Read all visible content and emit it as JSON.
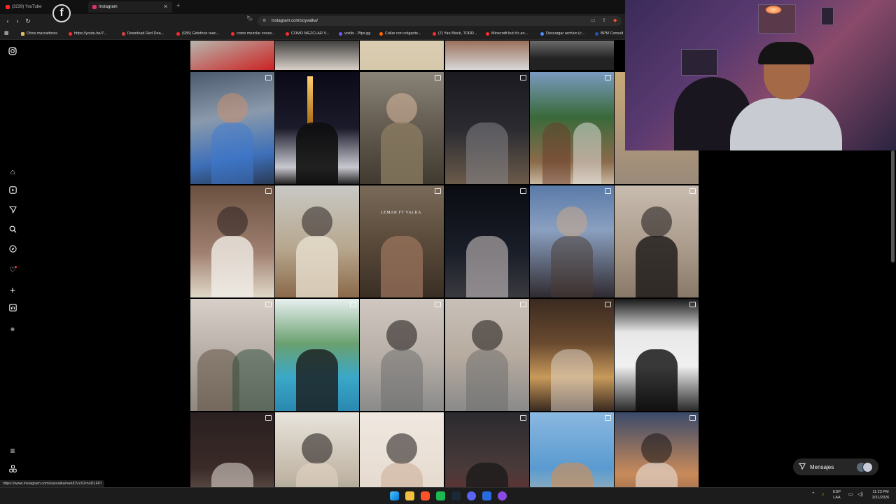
{
  "browser": {
    "tabs": [
      {
        "title": "(3239) YouTube",
        "favicon_color": "#ff2b2b"
      },
      {
        "title": "Instagram",
        "favicon_color": "#e1306c"
      }
    ],
    "new_tab_symbol": "+",
    "url": "instagram.com/soyvalka/",
    "bookmarks": [
      {
        "label": "Otros marcadores",
        "color": "#e0c060"
      },
      {
        "label": "https://youtu.be/7...",
        "color": "#ff2b2b"
      },
      {
        "label": "Download Red Dea...",
        "color": "#d44"
      },
      {
        "label": "(935) Girlofnox reac...",
        "color": "#ff2b2b"
      },
      {
        "label": "como mezclar voces...",
        "color": "#ff2b2b"
      },
      {
        "label": "COMO MEZCLAR V...",
        "color": "#ff2b2b"
      },
      {
        "label": "voxlis - Pfps.gg",
        "color": "#6a5cff"
      },
      {
        "label": "Collar con colgante...",
        "color": "#ff6a00"
      },
      {
        "label": "(7) Yan Block, TORR...",
        "color": "#ff2b2b"
      },
      {
        "label": "Minecraft but it's an...",
        "color": "#ff2b2b"
      },
      {
        "label": "Descargar archivo (c...",
        "color": "#4a8cff"
      },
      {
        "label": "BPM Consult",
        "color": "#2255aa"
      }
    ]
  },
  "overlay": {
    "facebook_glyph": "f"
  },
  "instagram": {
    "nav_icons": [
      "instagram-logo-icon",
      "home-icon",
      "reels-icon",
      "messages-icon",
      "search-icon",
      "explore-icon",
      "notifications-icon",
      "create-icon",
      "dashboard-icon",
      "threads-icon",
      "more-menu-icon",
      "also-from-meta-icon"
    ],
    "post_caption": "LEMAR FT VALKA",
    "messages_label": "Mensajes"
  },
  "status_bar_url": "https://www.instagram.com/soyvalka/reel/DVzX2moDLFP/",
  "taskbar": {
    "lang_line1": "ESP",
    "lang_line2": "LAA",
    "time": "11:23 PM",
    "date": "3/31/2026"
  }
}
